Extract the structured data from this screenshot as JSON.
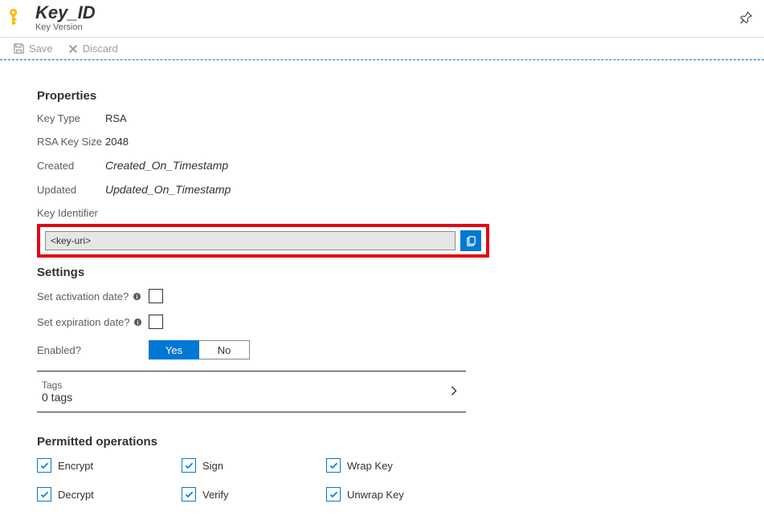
{
  "header": {
    "title": "Key_ID",
    "subtitle": "Key Version"
  },
  "toolbar": {
    "save": "Save",
    "discard": "Discard"
  },
  "properties": {
    "heading": "Properties",
    "key_type_label": "Key Type",
    "key_type_value": "RSA",
    "rsa_size_label": "RSA Key Size",
    "rsa_size_value": "2048",
    "created_label": "Created",
    "created_value": "Created_On_Timestamp",
    "updated_label": "Updated",
    "updated_value": "Updated_On_Timestamp",
    "key_identifier_label": "Key Identifier",
    "key_uri_value": "<key-uri>"
  },
  "settings": {
    "heading": "Settings",
    "activation_label": "Set activation date?",
    "expiration_label": "Set expiration date?",
    "enabled_label": "Enabled?",
    "yes": "Yes",
    "no": "No"
  },
  "tags": {
    "label": "Tags",
    "count": "0 tags"
  },
  "operations": {
    "heading": "Permitted operations",
    "encrypt": "Encrypt",
    "decrypt": "Decrypt",
    "sign": "Sign",
    "verify": "Verify",
    "wrap": "Wrap Key",
    "unwrap": "Unwrap Key"
  }
}
